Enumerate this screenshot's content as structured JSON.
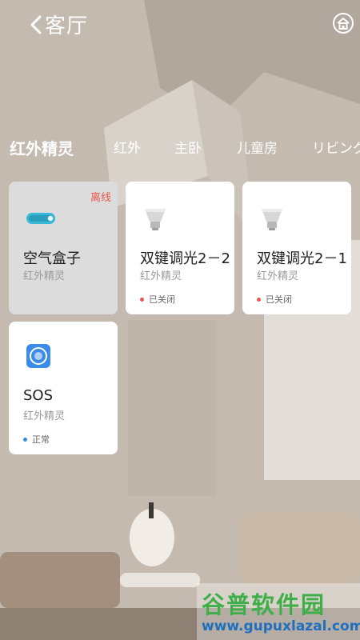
{
  "header": {
    "title": "客厅"
  },
  "tabs": [
    {
      "label": "红外精灵",
      "active": true
    },
    {
      "label": "红外"
    },
    {
      "label": "主卧"
    },
    {
      "label": "儿童房"
    },
    {
      "label": "リビング"
    }
  ],
  "devices": [
    {
      "name": "空气盒子",
      "room": "红外精灵",
      "status_tag": "离线",
      "icon": "air-box-icon"
    },
    {
      "name": "双键调光2－2",
      "room": "红外精灵",
      "status": "已关闭",
      "status_color": "#e8564f",
      "icon": "bulb-icon"
    },
    {
      "name": "双键调光2－1",
      "room": "红外精灵",
      "status": "已关闭",
      "status_color": "#e8564f",
      "icon": "bulb-icon"
    },
    {
      "name": "SOS",
      "room": "红外精灵",
      "status": "正常",
      "status_color": "#3b8beb",
      "icon": "sos-icon"
    }
  ],
  "watermark": {
    "line1": "谷普软件园",
    "line2": "www.gupuxlazal.com"
  },
  "colors": {
    "offline": "#e8564f",
    "closed": "#e8564f",
    "normal": "#3b8beb",
    "accent": "#39b7d6"
  }
}
